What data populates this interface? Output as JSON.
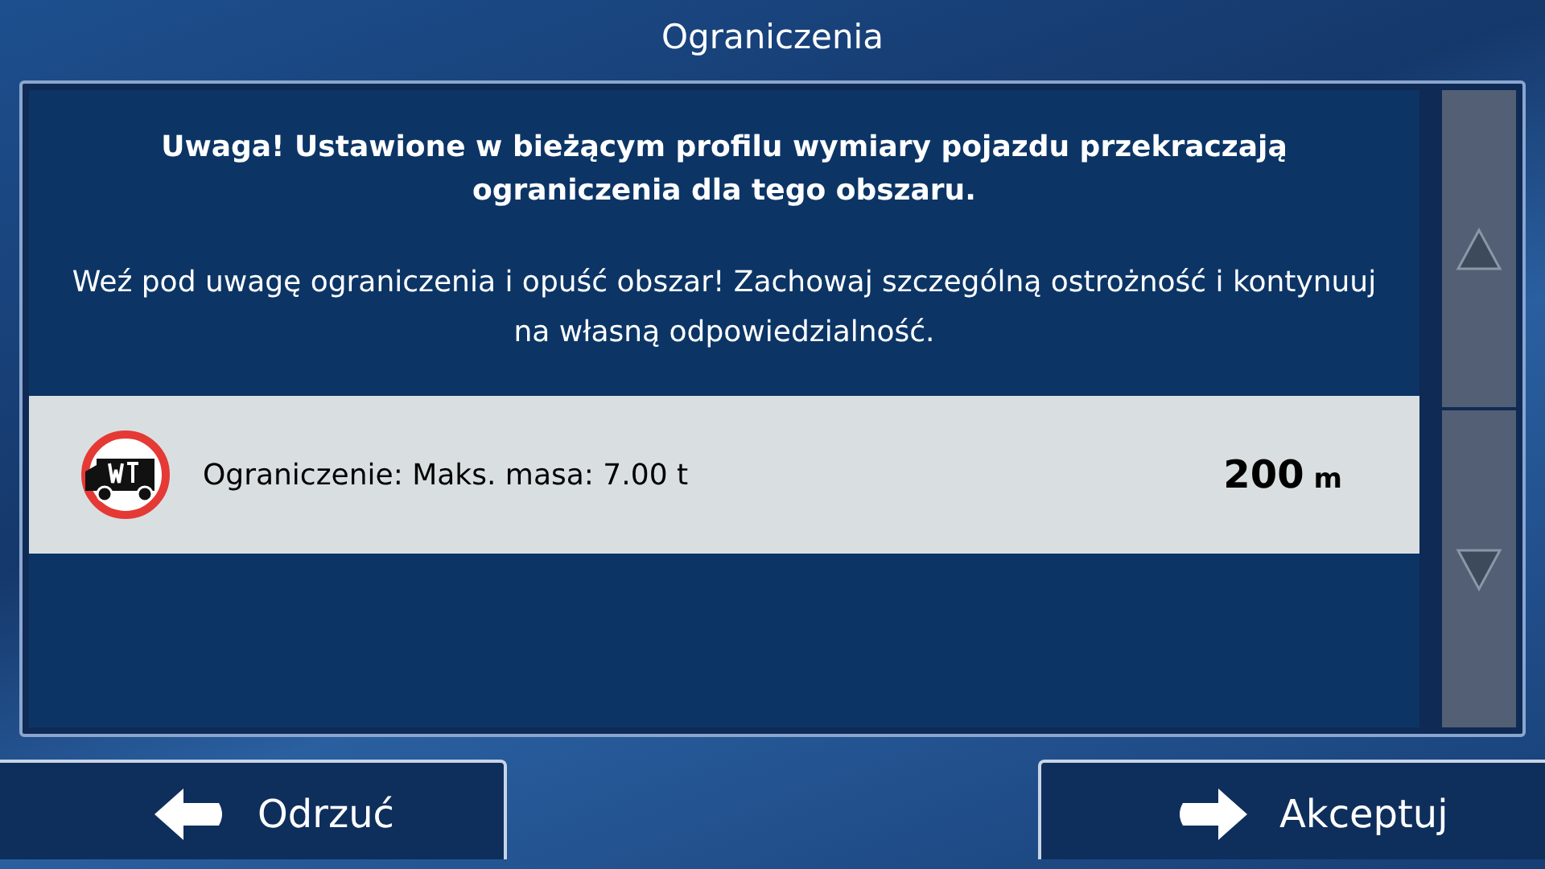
{
  "window": {
    "title": "Ograniczenia"
  },
  "warning": {
    "heading": "Uwaga! Ustawione w bieżącym profilu wymiary pojazdu przekraczają ograniczenia dla tego obszaru.",
    "message": "Weź pod uwagę ograniczenia i opuść obszar! Zachowaj szczególną ostrożność i kontynuuj na własną odpowiedzialność."
  },
  "restrictions": [
    {
      "label": "Ograniczenie: Maks. masa: 7.00 t",
      "distance": "200",
      "unit": "m",
      "selected": true
    }
  ],
  "scroll_buttons": [
    {
      "kind": "up"
    },
    {
      "kind": "down"
    }
  ],
  "buttons": [
    {
      "kind": "back",
      "label": "Odrzuć"
    },
    {
      "kind": "forward",
      "label": "Akceptuj"
    }
  ]
}
